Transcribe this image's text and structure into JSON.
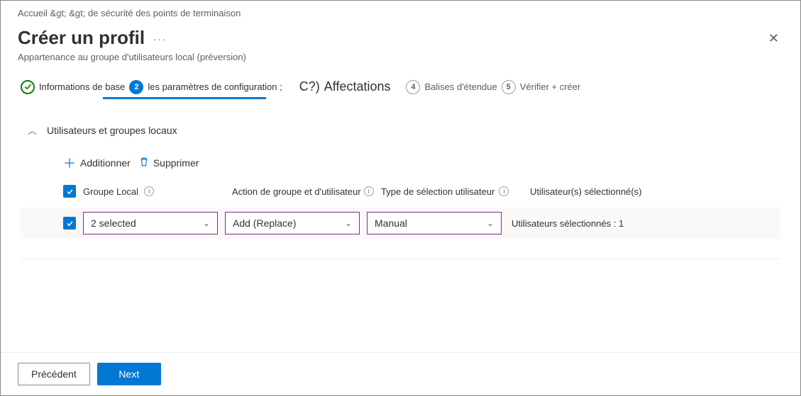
{
  "breadcrumb": "Accueil &gt;   &gt; de sécurité des points de terminaison",
  "title": "Créer un profil",
  "subtitle": "Appartenance au groupe d'utilisateurs local (préversion)",
  "steps": {
    "s1": "Informations de base",
    "s2": "les paramètres de configuration ;",
    "s3_num": "C?)",
    "s3": "Affectations",
    "s4_num": "4",
    "s4": "Balises d'étendue",
    "s5_num": "5",
    "s5": "Vérifier + créer"
  },
  "section": {
    "title": "Utilisateurs et groupes locaux"
  },
  "toolbar": {
    "add": "Additionner",
    "delete": "Supprimer"
  },
  "columns": {
    "local": "Groupe Local",
    "action": "Action de groupe et d'utilisateur",
    "type": "Type de sélection utilisateur",
    "users": "Utilisateur(s) sélectionné(s)"
  },
  "row": {
    "local": "2 selected",
    "action": "Add (Replace)",
    "type": "Manual",
    "users": "Utilisateurs sélectionnés : 1"
  },
  "footer": {
    "prev": "Précédent",
    "next": "Next"
  }
}
